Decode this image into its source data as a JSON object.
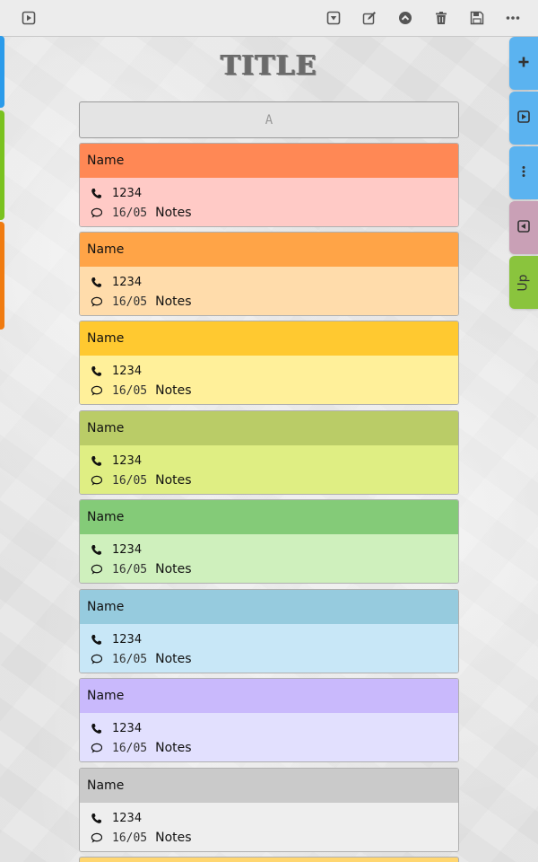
{
  "toolbar": {
    "left_icon": "play-square-icon",
    "right_icons": [
      "dropdown-square-icon",
      "edit-icon",
      "chevron-up-circle-icon",
      "trash-icon",
      "save-icon",
      "more-horizontal-icon"
    ]
  },
  "title": "TITLE",
  "letter_bar": {
    "label": "A"
  },
  "side_tabs": [
    {
      "icon": "plus-icon",
      "color": "#5bb3f0"
    },
    {
      "icon": "play-square-icon",
      "color": "#5bb3f0"
    },
    {
      "icon": "more-vertical-icon",
      "color": "#5bb3f0"
    },
    {
      "icon": "back-square-icon",
      "color": "#c9a0b6"
    },
    {
      "label": "Up",
      "color": "#8ac43d"
    }
  ],
  "left_strips": [
    {
      "color": "#2b9bea"
    },
    {
      "color": "#7ac21f"
    },
    {
      "color": "#f07b10"
    }
  ],
  "contacts": [
    {
      "name": "Name",
      "phone": "1234",
      "date": "16/05",
      "notes": "Notes",
      "head_color": "#ff8855",
      "body_color": "#ffcac6"
    },
    {
      "name": "Name",
      "phone": "1234",
      "date": "16/05",
      "notes": "Notes",
      "head_color": "#ffa447",
      "body_color": "#ffdcab"
    },
    {
      "name": "Name",
      "phone": "1234",
      "date": "16/05",
      "notes": "Notes",
      "head_color": "#ffc930",
      "body_color": "#fff09a"
    },
    {
      "name": "Name",
      "phone": "1234",
      "date": "16/05",
      "notes": "Notes",
      "head_color": "#bacc67",
      "body_color": "#dfee83"
    },
    {
      "name": "Name",
      "phone": "1234",
      "date": "16/05",
      "notes": "Notes",
      "head_color": "#84cb78",
      "body_color": "#cff0bd"
    },
    {
      "name": "Name",
      "phone": "1234",
      "date": "16/05",
      "notes": "Notes",
      "head_color": "#96cbde",
      "body_color": "#c8e7f7"
    },
    {
      "name": "Name",
      "phone": "1234",
      "date": "16/05",
      "notes": "Notes",
      "head_color": "#c9b9fc",
      "body_color": "#e2e0fe"
    },
    {
      "name": "Name",
      "phone": "1234",
      "date": "16/05",
      "notes": "Notes",
      "head_color": "#cacaca",
      "body_color": "#eeeeee"
    }
  ],
  "partial_card_color": "#ffd670"
}
